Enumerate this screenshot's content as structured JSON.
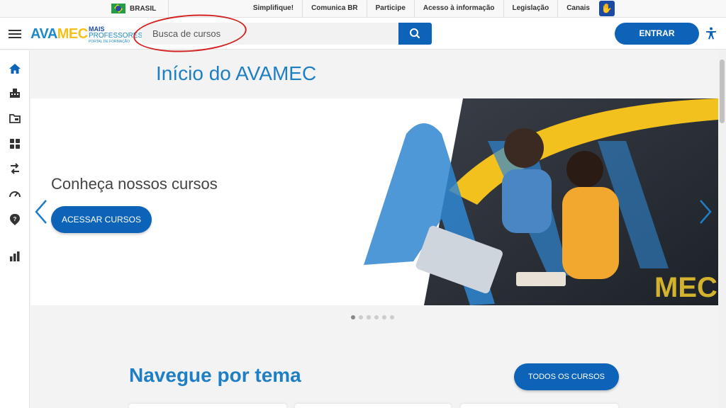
{
  "gov_bar": {
    "brasil": "BRASIL",
    "links": [
      "Simplifique!",
      "Comunica BR",
      "Participe",
      "Acesso à informação",
      "Legislação",
      "Canais"
    ]
  },
  "header": {
    "logo_ava": "AVA",
    "logo_mec": "MEC",
    "partner_line1": "MAIS",
    "partner_line2": "PROFESSORES",
    "partner_line3": "PORTAL DE FORMAÇÃO",
    "search_placeholder": "Busca de cursos",
    "enter_label": "ENTRAR"
  },
  "sidebar": {
    "icons": [
      "home-icon",
      "institution-icon",
      "folder-icon",
      "dashboard-icon",
      "transfer-icon",
      "speedometer-icon",
      "help-icon",
      "bar-chart-icon"
    ]
  },
  "main": {
    "title": "Início do AVAMEC",
    "banner": {
      "heading": "Conheça nossos cursos",
      "button": "ACESSAR CURSOS",
      "brand_text": "MEC",
      "slide_count": 6,
      "active_slide": 1
    },
    "nav_title": "Navegue por tema",
    "all_courses_button": "TODOS OS CURSOS"
  },
  "colors": {
    "primary": "#0c63b8",
    "title": "#1e7fc5",
    "accent_yellow": "#f3c11d",
    "annotation_red": "#d42222"
  }
}
